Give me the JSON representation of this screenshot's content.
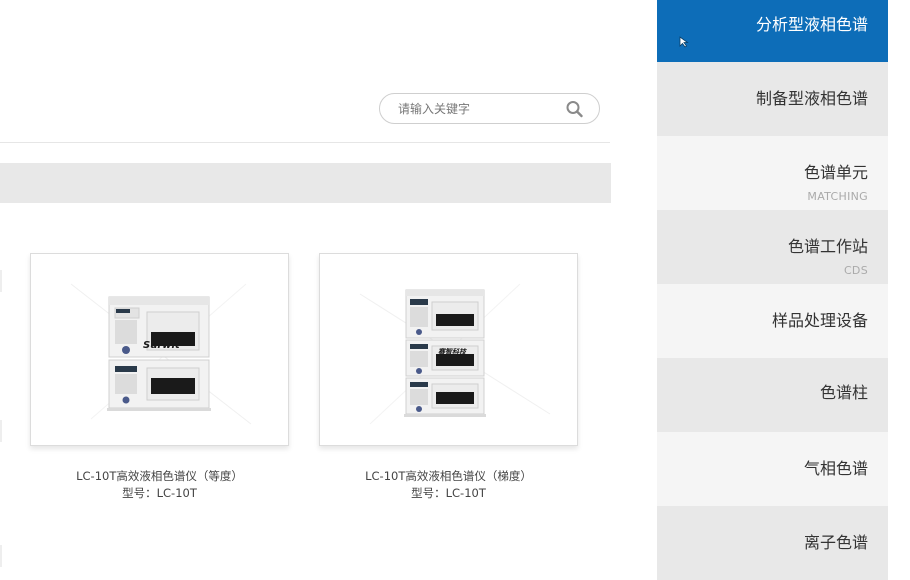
{
  "search": {
    "placeholder": "请输入关键字",
    "button_icon": "search-icon"
  },
  "products": [
    {
      "name": "LC-10T高效液相色谱仪（等度）",
      "model": "型号：LC-10T",
      "image_icon": "hplc-isocratic-instrument-image",
      "brand_text": "Surwit"
    },
    {
      "name": "LC-10T高效液相色谱仪（梯度）",
      "model": "型号：LC-10T",
      "image_icon": "hplc-gradient-instrument-image",
      "brand_text": "赛智科技"
    }
  ],
  "sidebar": {
    "items": [
      {
        "label": "分析型液相色谱",
        "sub": "",
        "state": "active"
      },
      {
        "label": "制备型液相色谱",
        "sub": "",
        "state": "dark"
      },
      {
        "label": "色谱单元",
        "sub": "MATCHING",
        "state": "light"
      },
      {
        "label": "色谱工作站",
        "sub": "CDS",
        "state": "dark"
      },
      {
        "label": "样品处理设备",
        "sub": "",
        "state": "light"
      },
      {
        "label": "色谱柱",
        "sub": "",
        "state": "dark"
      },
      {
        "label": "气相色谱",
        "sub": "",
        "state": "light"
      },
      {
        "label": "离子色谱",
        "sub": "",
        "state": "dark"
      }
    ]
  },
  "colors": {
    "accent": "#0d6db8",
    "sidebar_dark": "#e8e8e8",
    "sidebar_light": "#f5f5f5",
    "bar_grey": "#e8e8e8"
  }
}
